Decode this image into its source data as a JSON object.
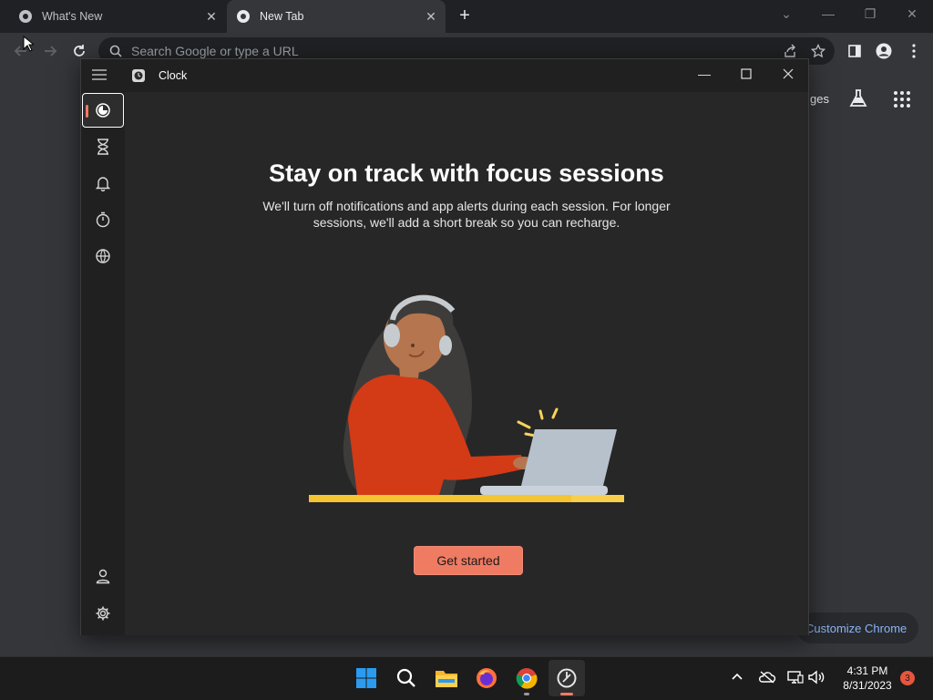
{
  "browser": {
    "tabs": [
      {
        "label": "What's New",
        "active": false
      },
      {
        "label": "New Tab",
        "active": true
      }
    ],
    "new_tab_symbol": "+",
    "omnibox_placeholder": "Search Google or type a URL",
    "partial_labels": {
      "images": "ges"
    },
    "customize_label": "Customize Chrome",
    "colors": {
      "tabstrip": "#202124",
      "toolbar": "#35363a",
      "accent_link": "#8ab4f8"
    }
  },
  "clock_app": {
    "title": "Clock",
    "nav_items": [
      {
        "name": "focus-sessions",
        "icon": "focus-icon",
        "selected": true
      },
      {
        "name": "timer",
        "icon": "hourglass-icon",
        "selected": false
      },
      {
        "name": "alarm",
        "icon": "bell-icon",
        "selected": false
      },
      {
        "name": "stopwatch",
        "icon": "stopwatch-icon",
        "selected": false
      },
      {
        "name": "world-clock",
        "icon": "globe-icon",
        "selected": false
      }
    ],
    "bottom_nav": [
      {
        "name": "account",
        "icon": "person-icon"
      },
      {
        "name": "settings",
        "icon": "gear-icon"
      }
    ],
    "heading": "Stay on track with focus sessions",
    "description": "We'll turn off notifications and app alerts during each session. For longer sessions, we'll add a short break so you can recharge.",
    "cta": "Get started",
    "colors": {
      "accent": "#ef7b63",
      "nav_selected_bar": "#ef7b63",
      "background": "#272727"
    }
  },
  "taskbar": {
    "apps": [
      {
        "name": "start",
        "icon": "windows-icon"
      },
      {
        "name": "search",
        "icon": "search-icon"
      },
      {
        "name": "file-explorer",
        "icon": "folder-icon"
      },
      {
        "name": "firefox",
        "icon": "firefox-icon"
      },
      {
        "name": "chrome",
        "icon": "chrome-icon"
      },
      {
        "name": "clock",
        "icon": "clock-icon"
      }
    ],
    "time": "4:31 PM",
    "date": "8/31/2023",
    "notification_count": "3"
  }
}
